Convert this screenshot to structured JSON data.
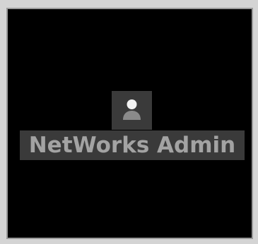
{
  "login": {
    "user_name": "NetWorks Admin",
    "avatar_icon": "user-icon"
  },
  "colors": {
    "background": "#000000",
    "tile": "#3a3a3a",
    "text": "#a3a3a3",
    "frame": "#d4d4d4"
  }
}
